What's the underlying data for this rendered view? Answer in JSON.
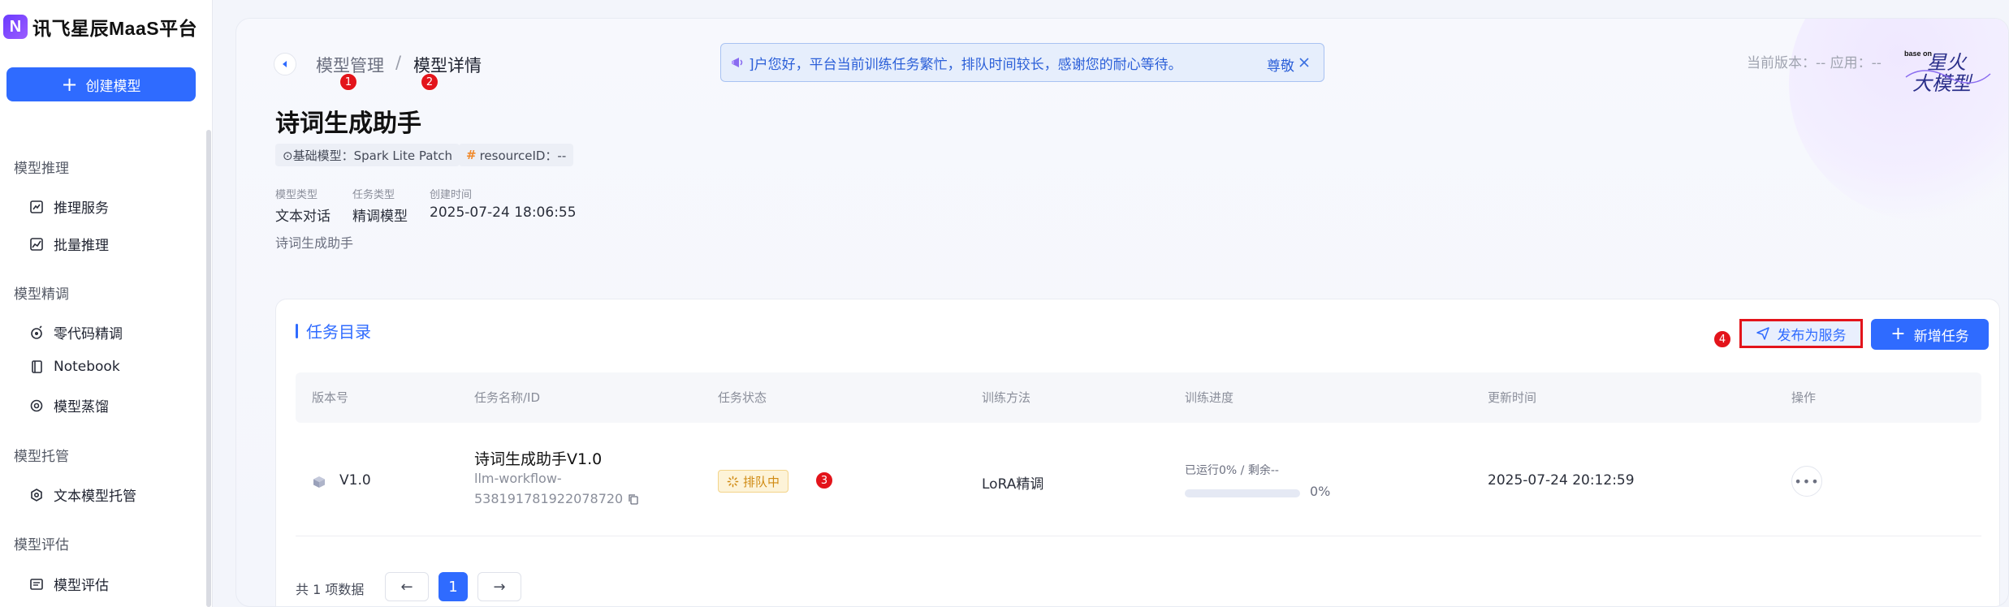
{
  "brand": {
    "logo_letter": "N",
    "title": "讯飞星辰MaaS平台"
  },
  "sidebar": {
    "create_label": "创建模型",
    "groups": [
      {
        "title": "模型推理",
        "items": [
          {
            "label": "推理服务",
            "icon": "chart-line-icon"
          },
          {
            "label": "批量推理",
            "icon": "chart-area-icon"
          }
        ]
      },
      {
        "title": "模型精调",
        "items": [
          {
            "label": "零代码精调",
            "icon": "tune-icon"
          },
          {
            "label": "Notebook",
            "icon": "notebook-icon"
          },
          {
            "label": "模型蒸馏",
            "icon": "distill-icon"
          }
        ]
      },
      {
        "title": "模型托管",
        "items": [
          {
            "label": "文本模型托管",
            "icon": "hosting-icon"
          }
        ]
      },
      {
        "title": "模型评估",
        "items": [
          {
            "label": "模型评估",
            "icon": "evaluation-icon"
          }
        ]
      }
    ]
  },
  "breadcrumb": {
    "parent": "模型管理",
    "sep": "/",
    "current": "模型详情"
  },
  "markers": [
    "1",
    "2",
    "3",
    "4"
  ],
  "notice": {
    "text": "]户您好，平台当前训练任务繁忙，排队时间较长，感谢您的耐心等待。",
    "trailing": "尊敬",
    "color": "#2b5fd8"
  },
  "top_meta": "当前版本：--   应用：--",
  "spark_logo": {
    "base_on": "base on",
    "line1": "星火",
    "line2": "大模型"
  },
  "model": {
    "title": "诗词生成助手",
    "base_model_tag": "⊙基础模型：Spark Lite Patch",
    "resource_hash": "#",
    "resource_tag": "resourceID：--",
    "meta": [
      {
        "label": "模型类型",
        "value": "文本对话"
      },
      {
        "label": "任务类型",
        "value": "精调模型"
      },
      {
        "label": "创建时间",
        "value": "2025-07-24 18:06:55"
      }
    ],
    "description": "诗词生成助手"
  },
  "tasks": {
    "title": "任务目录",
    "publish_label": "发布为服务",
    "new_label": "新增任务",
    "columns": [
      "版本号",
      "任务名称/ID",
      "任务状态",
      "训练方法",
      "训练进度",
      "更新时间",
      "操作"
    ],
    "rows": [
      {
        "version": "V1.0",
        "name": "诗词生成助手V1.0",
        "id_line1": "llm-workflow-",
        "id_line2": "538191781922078720",
        "status": "排队中",
        "method": "LoRA精调",
        "progress_text": "已运行0% / 剩余--",
        "progress": 0,
        "progress_pct": "0%",
        "updated": "2025-07-24 20:12:59",
        "action": "•••"
      }
    ],
    "total": "共 1 项数据",
    "pagination": {
      "prev": "←",
      "page": "1",
      "next": "→"
    }
  },
  "colors": {
    "primary": "#2f6bff",
    "marker": "#e3141b",
    "queue": "#d08a12"
  }
}
